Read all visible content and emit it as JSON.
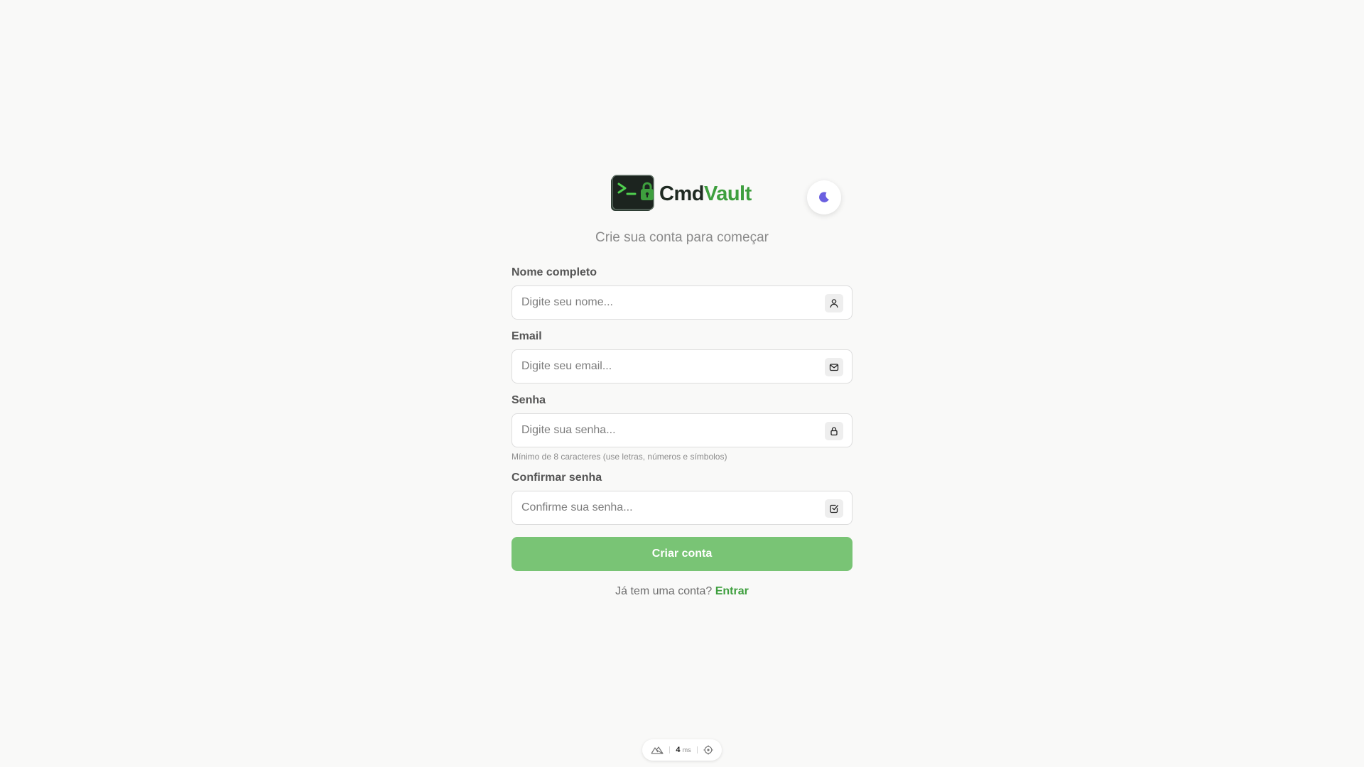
{
  "brand": {
    "name_part1": "Cmd",
    "name_part2": "Vault",
    "primary_color": "#3e9f3e",
    "button_color": "#79c475"
  },
  "theme_toggle": {
    "icon": "moon-icon"
  },
  "subtitle": "Crie sua conta para começar",
  "form": {
    "name": {
      "label": "Nome completo",
      "placeholder": "Digite seu nome...",
      "icon": "user-icon"
    },
    "email": {
      "label": "Email",
      "placeholder": "Digite seu email...",
      "icon": "mail-icon"
    },
    "password": {
      "label": "Senha",
      "placeholder": "Digite sua senha...",
      "hint": "Mínimo de 8 caracteres (use letras, números e símbolos)",
      "icon": "lock-icon"
    },
    "confirm_password": {
      "label": "Confirmar senha",
      "placeholder": "Confirme sua senha...",
      "icon": "check-square-icon"
    },
    "submit_label": "Criar conta"
  },
  "signin": {
    "prompt": "Já tem uma conta?",
    "link_label": "Entrar"
  },
  "dev_indicator": {
    "ms_value": "4",
    "ms_unit": "ms"
  }
}
